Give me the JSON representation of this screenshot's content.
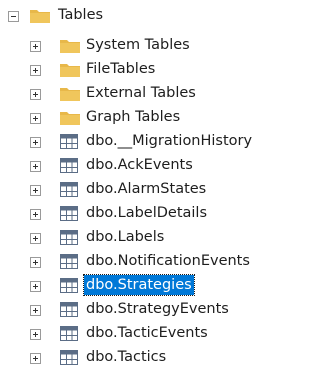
{
  "tree": {
    "root": {
      "label": "Tables",
      "expanded": true
    },
    "folders": [
      {
        "label": "System Tables"
      },
      {
        "label": "FileTables"
      },
      {
        "label": "External Tables"
      },
      {
        "label": "Graph Tables"
      }
    ],
    "tables": [
      {
        "label": "dbo.__MigrationHistory"
      },
      {
        "label": "dbo.AckEvents"
      },
      {
        "label": "dbo.AlarmStates"
      },
      {
        "label": "dbo.LabelDetails"
      },
      {
        "label": "dbo.Labels"
      },
      {
        "label": "dbo.NotificationEvents"
      },
      {
        "label": "dbo.Strategies",
        "selected": true
      },
      {
        "label": "dbo.StrategyEvents"
      },
      {
        "label": "dbo.TacticEvents"
      },
      {
        "label": "dbo.Tactics"
      }
    ]
  },
  "colors": {
    "folder": "#e8b84a",
    "table_icon": "#5b6d86",
    "selection": "#0078d7"
  },
  "icons": {
    "expand": "plus-box-icon",
    "collapse": "minus-box-icon",
    "folder": "folder-icon",
    "table": "table-icon"
  }
}
